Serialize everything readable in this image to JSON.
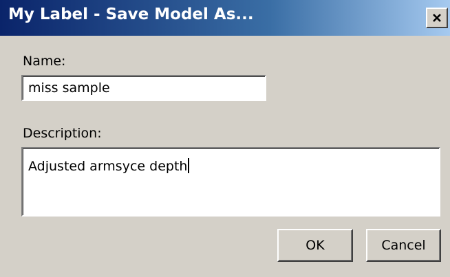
{
  "window": {
    "title": "My Label - Save Model As...",
    "close_icon": "close-icon"
  },
  "form": {
    "name_label": "Name:",
    "name_value": "miss sample",
    "description_label": "Description:",
    "description_value": "Adjusted armsyce depth"
  },
  "buttons": {
    "ok_label": "OK",
    "cancel_label": "Cancel"
  },
  "colors": {
    "titlebar_start": "#0a246a",
    "titlebar_end": "#a6caf0",
    "dialog_background": "#d4d0c8"
  }
}
